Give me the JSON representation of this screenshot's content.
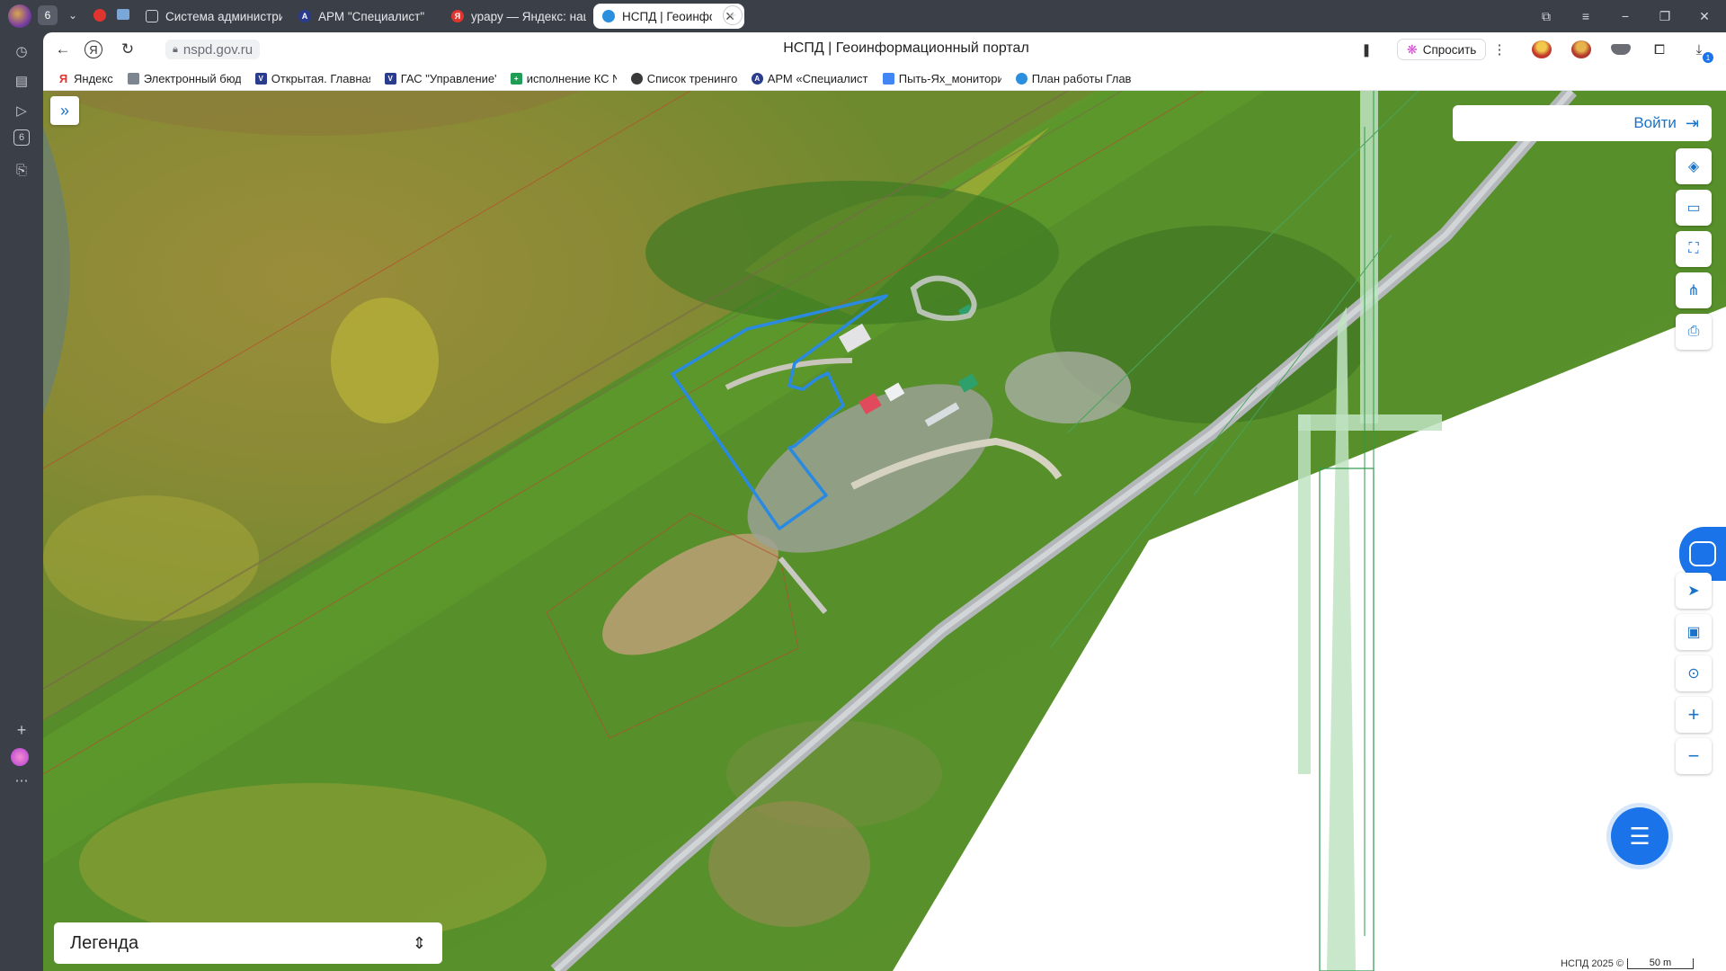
{
  "browser": {
    "tab_count_badge": "6",
    "tabs": [
      {
        "label": "Система администриров",
        "fav_color": "#6b6e76"
      },
      {
        "label": "АРМ \"Специалист\"",
        "fav_color": "#2b3c8f"
      },
      {
        "label": "урару — Яндекс: нашлос",
        "fav_color": "#e0342f"
      },
      {
        "label": "НСПД | Геоинформаци",
        "fav_color": "#2b8fe0"
      }
    ],
    "address": "nspd.gov.ru",
    "page_title": "НСПД | Геоинформационный портал",
    "ask_button": "Спросить",
    "download_badge": "1",
    "left_badge": "6"
  },
  "bookmarks": [
    {
      "label": "Яндекс",
      "color": "#e0342f",
      "glyph": "Я"
    },
    {
      "label": "Электронный бюджет",
      "color": "#7d8590",
      "glyph": "▦"
    },
    {
      "label": "Открытая. Главная",
      "color": "#2b3c8f",
      "glyph": "V"
    },
    {
      "label": "ГАС \"Управление\"",
      "color": "#2b3c8f",
      "glyph": "V"
    },
    {
      "label": "исполнение КС №",
      "color": "#1f9d55",
      "glyph": "+"
    },
    {
      "label": "Список тренингов",
      "color": "#3a3a3a",
      "glyph": "◉"
    },
    {
      "label": "АРМ «Специалист»",
      "color": "#2b3c8f",
      "glyph": "A"
    },
    {
      "label": "Пыть-Ях_мониторинг",
      "color": "#4285f4",
      "glyph": "▤"
    },
    {
      "label": "План работы Глав",
      "color": "#2b8fe0",
      "glyph": "⌒"
    }
  ],
  "map": {
    "login_label": "Войти",
    "legend_label": "Легенда",
    "copyright": "НСПД 2025 ©",
    "scale_label": "50 m"
  },
  "icons": {
    "expand": "»",
    "layers": "◈",
    "ruler": "▭",
    "select": "⛶",
    "share": "⋔",
    "print": "⎙",
    "navigate": "➤",
    "minimap": "▣",
    "geolocate": "⊙",
    "zoom_in": "+",
    "zoom_out": "−",
    "chat": "☰",
    "login_arrow": "⇥",
    "legend_toggle": "⇕"
  }
}
